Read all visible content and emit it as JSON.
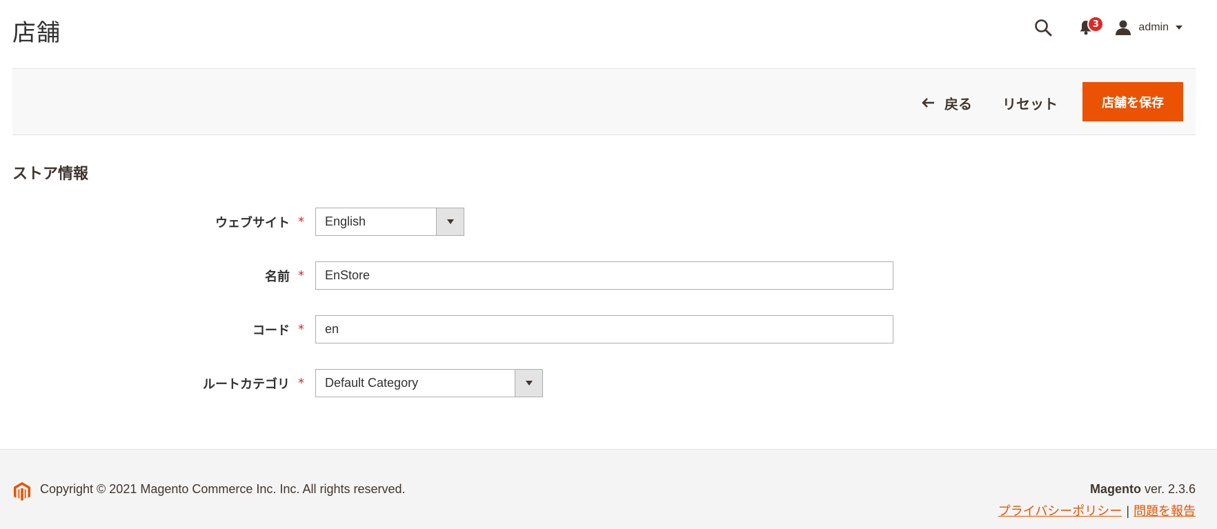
{
  "page": {
    "title": "店舗"
  },
  "header": {
    "search_icon": "search-icon",
    "notifications": {
      "icon": "bell-icon",
      "count": "3"
    },
    "user": {
      "icon": "user-icon",
      "name": "admin"
    }
  },
  "actions": {
    "back_label": "戻る",
    "reset_label": "リセット",
    "save_label": "店舗を保存"
  },
  "section": {
    "title": "ストア情報"
  },
  "form": {
    "required_mark": "*",
    "website": {
      "label": "ウェブサイト",
      "value": "English"
    },
    "name": {
      "label": "名前",
      "value": "EnStore"
    },
    "code": {
      "label": "コード",
      "value": "en"
    },
    "root_category": {
      "label": "ルートカテゴリ",
      "value": "Default Category"
    }
  },
  "footer": {
    "copyright": "Copyright © 2021 Magento Commerce Inc. Inc. All rights reserved.",
    "brand": "Magento",
    "version": " ver. 2.3.6",
    "privacy_link": "プライバシーポリシー",
    "separator": "|",
    "report_link": "問題を報告"
  },
  "colors": {
    "accent": "#eb5202",
    "badge": "#e22626",
    "required": "#e22626"
  }
}
